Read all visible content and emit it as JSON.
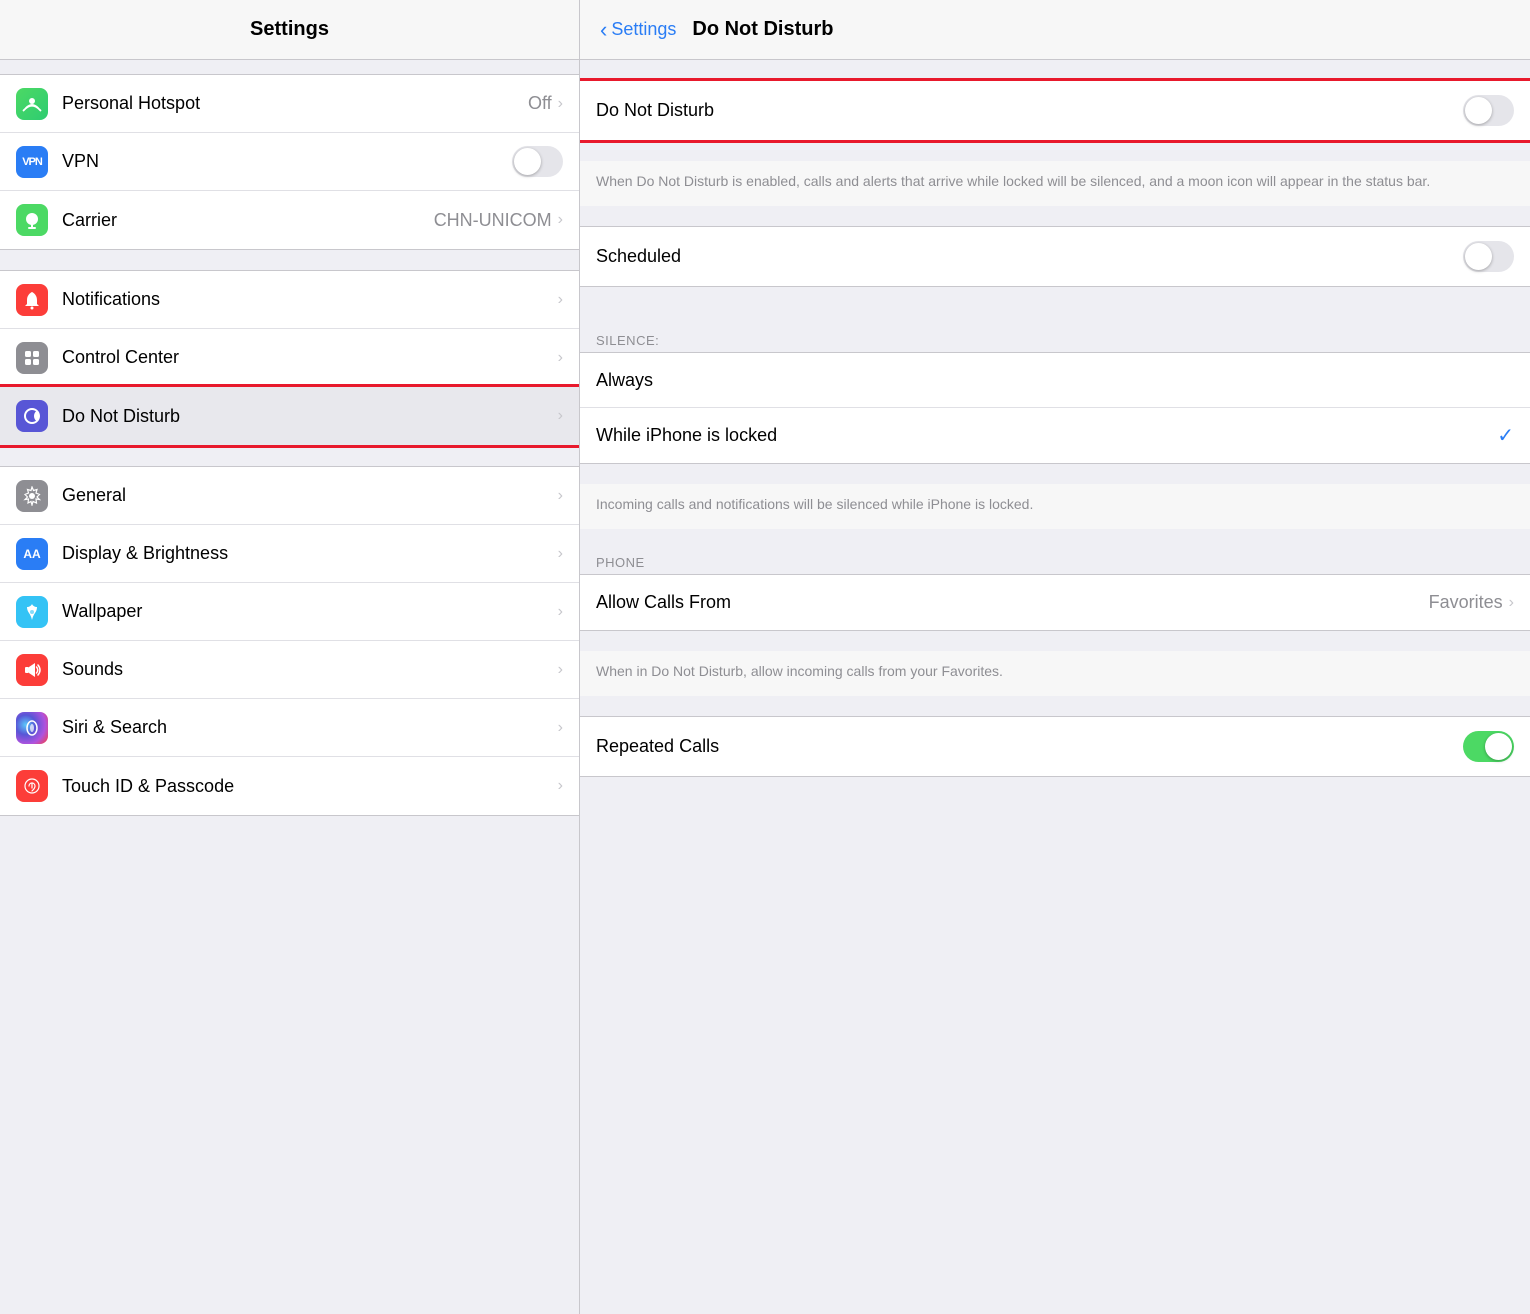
{
  "left": {
    "title": "Settings",
    "sections": [
      {
        "id": "network",
        "items": [
          {
            "id": "personal-hotspot",
            "label": "Personal Hotspot",
            "value": "Off",
            "hasChevron": true,
            "icon": "hotspot",
            "iconText": "⊗"
          },
          {
            "id": "vpn",
            "label": "VPN",
            "hasToggle": true,
            "toggleOn": false,
            "icon": "vpn",
            "iconText": "VPN"
          },
          {
            "id": "carrier",
            "label": "Carrier",
            "value": "CHN-UNICOM",
            "hasChevron": true,
            "icon": "carrier",
            "iconText": "📞"
          }
        ]
      },
      {
        "id": "system",
        "items": [
          {
            "id": "notifications",
            "label": "Notifications",
            "hasChevron": true,
            "icon": "notifications",
            "iconText": "🔔",
            "highlighted": false
          },
          {
            "id": "control-center",
            "label": "Control Center",
            "hasChevron": true,
            "icon": "control-center",
            "iconText": "⊞"
          },
          {
            "id": "do-not-disturb",
            "label": "Do Not Disturb",
            "hasChevron": true,
            "icon": "do-not-disturb",
            "iconText": "☽",
            "highlighted": true
          }
        ]
      },
      {
        "id": "preferences",
        "items": [
          {
            "id": "general",
            "label": "General",
            "hasChevron": true,
            "icon": "general",
            "iconText": "⚙"
          },
          {
            "id": "display",
            "label": "Display & Brightness",
            "hasChevron": true,
            "icon": "display",
            "iconText": "AA"
          },
          {
            "id": "wallpaper",
            "label": "Wallpaper",
            "hasChevron": true,
            "icon": "wallpaper",
            "iconText": "❋"
          },
          {
            "id": "sounds",
            "label": "Sounds",
            "hasChevron": true,
            "icon": "sounds",
            "iconText": "🔊"
          },
          {
            "id": "siri",
            "label": "Siri & Search",
            "hasChevron": true,
            "icon": "siri",
            "iconText": "◎"
          },
          {
            "id": "touchid",
            "label": "Touch ID & Passcode",
            "hasChevron": true,
            "icon": "touchid",
            "iconText": "⊙"
          }
        ]
      }
    ]
  },
  "right": {
    "backLabel": "Settings",
    "title": "Do Not Disturb",
    "mainToggle": {
      "label": "Do Not Disturb",
      "on": false,
      "highlighted": true
    },
    "mainDescription": "When Do Not Disturb is enabled, calls and alerts that arrive while locked will be silenced, and a moon icon will appear in the status bar.",
    "scheduled": {
      "label": "Scheduled",
      "on": false
    },
    "silenceSection": {
      "header": "SILENCE:",
      "items": [
        {
          "id": "always",
          "label": "Always",
          "checked": false
        },
        {
          "id": "while-locked",
          "label": "While iPhone is locked",
          "checked": true
        }
      ],
      "description": "Incoming calls and notifications will be silenced while iPhone is locked."
    },
    "phoneSection": {
      "header": "PHONE",
      "items": [
        {
          "id": "allow-calls-from",
          "label": "Allow Calls From",
          "value": "Favorites",
          "hasChevron": true
        }
      ],
      "description": "When in Do Not Disturb, allow incoming calls from your Favorites."
    },
    "repeatedCalls": {
      "label": "Repeated Calls",
      "on": true
    }
  }
}
